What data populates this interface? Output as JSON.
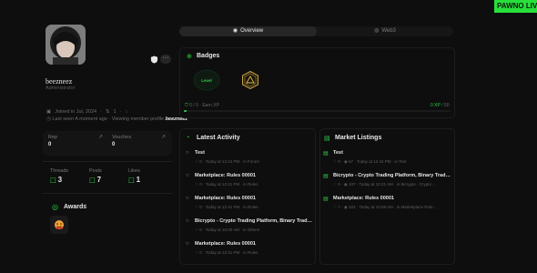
{
  "live_banner": "PAWNO LIVE",
  "profile": {
    "username": "beezneez",
    "role": "Administrator",
    "joined": "Joined in Jul, 2024",
    "posts_short": "1",
    "last_seen": "Last seen A moment ago · Viewing member profile",
    "viewing_name": "beezneez",
    "more_label": "···"
  },
  "stats": {
    "rep_label": "Rep",
    "rep_value": "0",
    "vouches_label": "Vouches",
    "vouches_value": "0",
    "threads_label": "Threads",
    "threads_value": "3",
    "posts_label": "Posts",
    "posts_value": "7",
    "likes_label": "Likes",
    "likes_value": "1"
  },
  "awards": {
    "title": "Awards",
    "count": "1"
  },
  "tabs": [
    {
      "label": "Overview",
      "active": true
    },
    {
      "label": "Web3",
      "active": false
    }
  ],
  "badges": {
    "title": "Badges",
    "level_label": "Level",
    "footer_left_count": "0 / 0",
    "footer_left_extra": "Earn XP",
    "footer_right_xp": "0 XP",
    "footer_right_total": "/ 50",
    "progress": 0.01
  },
  "latest_activity": {
    "title": "Latest Activity",
    "items": [
      {
        "title": "Test",
        "likes": "0",
        "time": "Today at 12:44 PM",
        "forum": "Forum"
      },
      {
        "title": "Marketplace: Rules 00001",
        "likes": "0",
        "time": "Today at 12:41 PM",
        "forum": "Rules"
      },
      {
        "title": "Marketplace: Rules 00001",
        "likes": "0",
        "time": "Today at 12:41 PM",
        "forum": "Rules"
      },
      {
        "title": "Bicrypto - Crypto Trading Platform, Binary Trading, ...",
        "likes": "0",
        "time": "Today at 10:00 AM",
        "forum": "Others"
      },
      {
        "title": "Marketplace: Rules 00001",
        "likes": "0",
        "time": "Today at 12:41 PM",
        "forum": "Rules"
      }
    ]
  },
  "market_listings": {
    "title": "Market Listings",
    "items": [
      {
        "title": "Test",
        "a": "0",
        "b": "67",
        "time": "Today at 12:44 PM",
        "forum": "Test"
      },
      {
        "title": "Bicrypto - Crypto Trading Platform, Binary Trading, ...",
        "a": "0",
        "b": "107",
        "time": "Today at 10:21 AM",
        "forum": "Bicrypto - Crypto ..."
      },
      {
        "title": "Marketplace: Rules 00001",
        "a": "7",
        "b": "322",
        "time": "Today at 10:09 AM",
        "forum": "Marketplace Rule..."
      }
    ]
  },
  "colors": {
    "accent": "#2ecf45",
    "background": "#0e0e0e",
    "live": "#27e03a"
  }
}
